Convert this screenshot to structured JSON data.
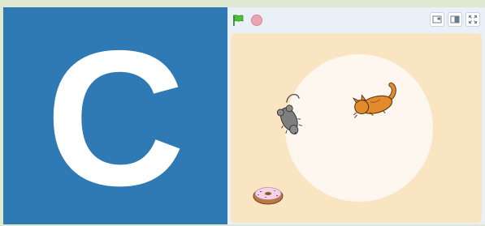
{
  "left_panel": {
    "letter": "C",
    "background_color": "#2f79b4",
    "letter_color": "#ffffff"
  },
  "toolbar": {
    "green_flag_icon": "green-flag-icon",
    "stop_icon": "stop-icon",
    "small_stage_icon": "small-stage-icon",
    "normal_stage_icon": "normal-stage-icon",
    "fullscreen_icon": "fullscreen-icon"
  },
  "stage": {
    "background_color": "#fae5c3",
    "circle_color": "#fdf7f0",
    "sprites": [
      "mouse-sprite",
      "cat-sprite",
      "donut-sprite"
    ]
  }
}
